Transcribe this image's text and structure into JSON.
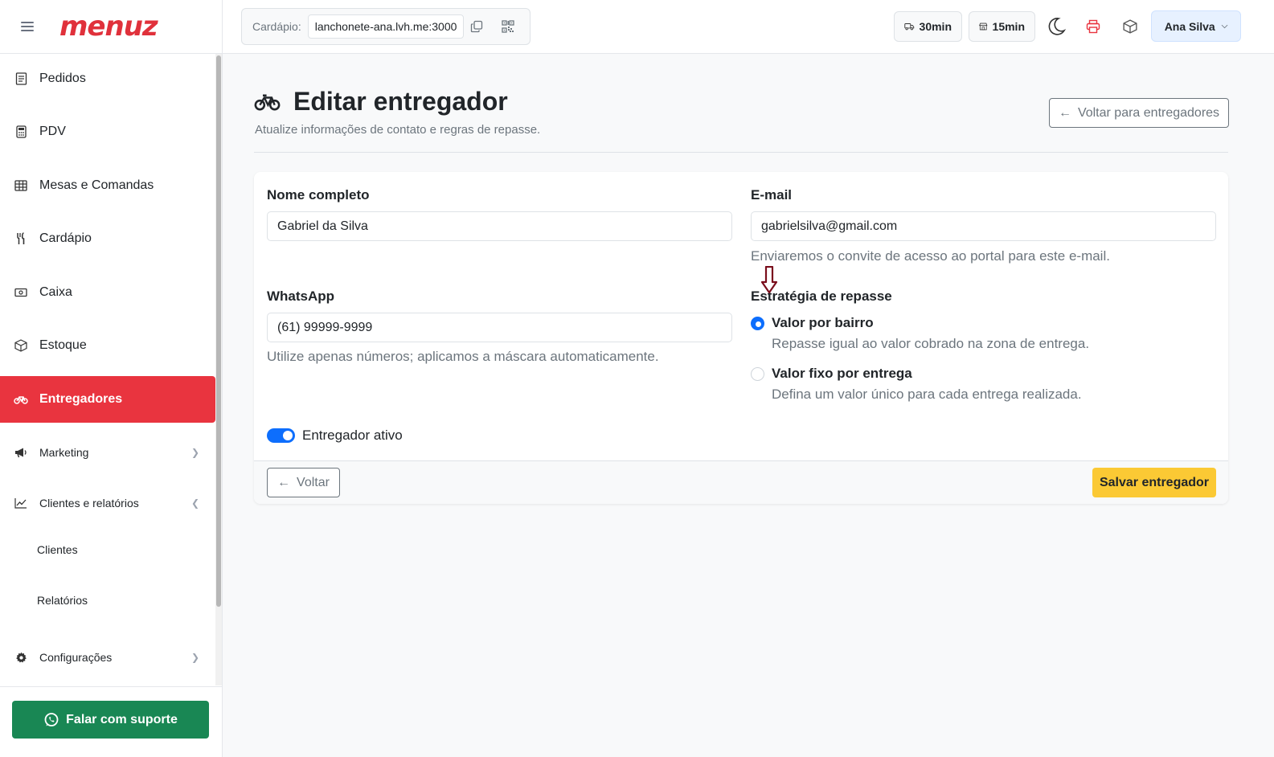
{
  "brand": {
    "logo": "menuz",
    "accent": "#e9343f"
  },
  "sidebar": {
    "items": [
      {
        "label": "Pedidos",
        "icon": "receipt-icon"
      },
      {
        "label": "PDV",
        "icon": "calculator-icon"
      },
      {
        "label": "Mesas e Comandas",
        "icon": "table-icon"
      },
      {
        "label": "Cardápio",
        "icon": "utensils-icon"
      },
      {
        "label": "Caixa",
        "icon": "cash-icon"
      },
      {
        "label": "Estoque",
        "icon": "box-icon"
      },
      {
        "label": "Entregadores",
        "icon": "bicycle-icon",
        "active": true
      },
      {
        "label": "Marketing",
        "icon": "megaphone-icon"
      },
      {
        "label": "Clientes e relatórios",
        "icon": "chart-line-icon"
      },
      {
        "label": "Clientes"
      },
      {
        "label": "Relatórios"
      },
      {
        "label": "Configurações",
        "icon": "gear-icon"
      }
    ],
    "support_label": "Falar com suporte"
  },
  "topbar": {
    "cardapio_label": "Cardápio:",
    "cardapio_url": "lanchonete-ana.lvh.me:3000",
    "delivery_time": "30min",
    "pickup_time": "15min",
    "user_name": "Ana Silva"
  },
  "page": {
    "title": "Editar entregador",
    "subtitle": "Atualize informações de contato e regras de repasse.",
    "back_top_label": "Voltar para entregadores"
  },
  "form": {
    "name_label": "Nome completo",
    "name_value": "Gabriel da Silva",
    "email_label": "E-mail",
    "email_value": "gabrielsilva@gmail.com",
    "email_hint": "Enviaremos o convite de acesso ao portal para este e-mail.",
    "whatsapp_label": "WhatsApp",
    "whatsapp_value": "(61) 99999-9999",
    "whatsapp_hint": "Utilize apenas números; aplicamos a máscara automaticamente.",
    "strategy_label": "Estratégia de repasse",
    "strategy_options": [
      {
        "title": "Valor por bairro",
        "desc": "Repasse igual ao valor cobrado na zona de entrega.",
        "checked": true
      },
      {
        "title": "Valor fixo por entrega",
        "desc": "Defina um valor único para cada entrega realizada.",
        "checked": false
      }
    ],
    "active_label": "Entregador ativo",
    "active": true
  },
  "footer": {
    "back_label": "Voltar",
    "save_label": "Salvar entregador"
  }
}
